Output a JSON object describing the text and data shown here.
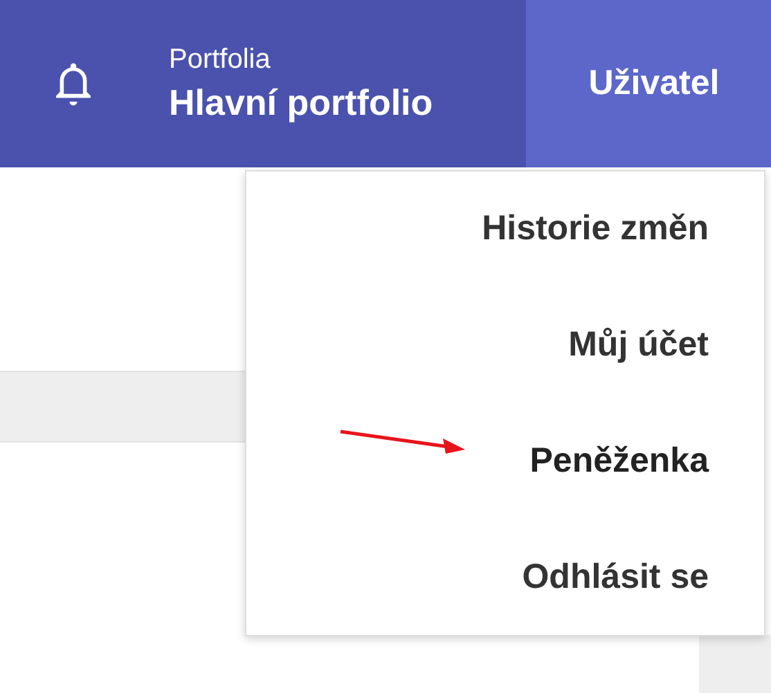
{
  "header": {
    "portfolio_label": "Portfolia",
    "portfolio_name": "Hlavní portfolio",
    "user_button": "Uživatel"
  },
  "user_menu": {
    "items": [
      {
        "label": "Historie změn",
        "highlighted": false
      },
      {
        "label": "Můj účet",
        "highlighted": false
      },
      {
        "label": "Peněženka",
        "highlighted": true
      },
      {
        "label": "Odhlásit se",
        "highlighted": false
      }
    ]
  }
}
